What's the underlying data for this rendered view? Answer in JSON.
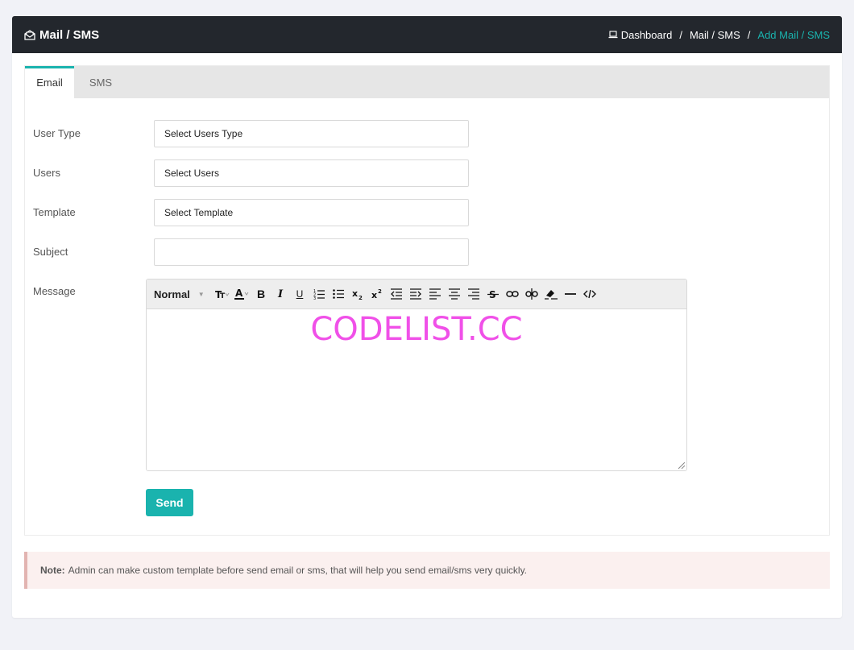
{
  "header": {
    "title": "Mail / SMS",
    "breadcrumb": {
      "dashboard": "Dashboard",
      "mail_sms": "Mail / SMS",
      "current": "Add Mail / SMS"
    }
  },
  "tabs": [
    {
      "label": "Email",
      "active": true
    },
    {
      "label": "SMS",
      "active": false
    }
  ],
  "form": {
    "user_type": {
      "label": "User Type",
      "value": "Select Users Type"
    },
    "users": {
      "label": "Users",
      "value": "Select Users"
    },
    "template": {
      "label": "Template",
      "value": "Select Template"
    },
    "subject": {
      "label": "Subject",
      "value": ""
    },
    "message": {
      "label": "Message",
      "format_select": "Normal",
      "body_text": "CODELIST.CC"
    },
    "send_label": "Send"
  },
  "note": {
    "label": "Note:",
    "text": "Admin can make custom template before send email or sms, that will help you send email/sms very quickly."
  },
  "colors": {
    "accent": "#1ab3ae",
    "header_bg": "#23272d",
    "note_bg": "#fbf0ef",
    "note_border": "#e2b4b1",
    "watermark": "#f050e8"
  },
  "icons": {
    "header": "mail-open-icon",
    "dashboard": "laptop-icon"
  }
}
